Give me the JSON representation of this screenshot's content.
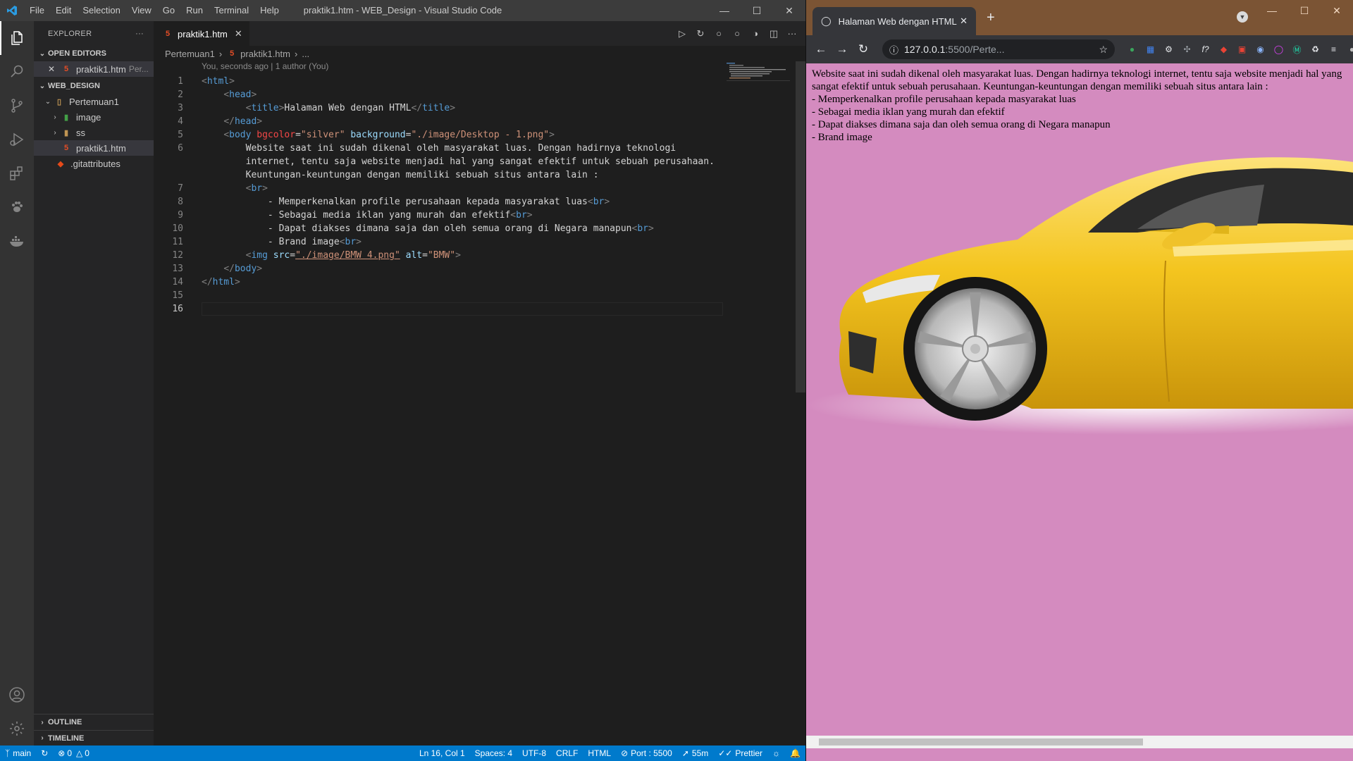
{
  "vscode": {
    "menu": [
      "File",
      "Edit",
      "Selection",
      "View",
      "Go",
      "Run",
      "Terminal",
      "Help"
    ],
    "window_title": "praktik1.htm - WEB_Design - Visual Studio Code",
    "explorer": {
      "title": "EXPLORER",
      "open_editors_label": "OPEN EDITORS",
      "open_editor": {
        "name": "praktik1.htm",
        "path": "Per..."
      },
      "workspace_label": "WEB_DESIGN",
      "tree": [
        {
          "name": "Pertemuan1"
        },
        {
          "name": "image"
        },
        {
          "name": "ss"
        },
        {
          "name": "praktik1.htm"
        },
        {
          "name": ".gitattributes"
        }
      ],
      "outline_label": "OUTLINE",
      "timeline_label": "TIMELINE"
    },
    "tab_label": "praktik1.htm",
    "breadcrumb": {
      "folder": "Pertemuan1",
      "file": "praktik1.htm",
      "more": "..."
    },
    "codelens": "You, seconds ago | 1 author (You)",
    "code": {
      "line_numbers": [
        "1",
        "2",
        "3",
        "4",
        "5",
        "6",
        "7",
        "8",
        "9",
        "10",
        "11",
        "12",
        "13",
        "14",
        "15",
        "16"
      ],
      "l1": {
        "open": "<",
        "tag": "html",
        "close": ">"
      },
      "l2": {
        "open": "<",
        "tag": "head",
        "close": ">"
      },
      "l3": {
        "tag_open": "title",
        "text": "Halaman Web dengan HTML",
        "tag_close": "title"
      },
      "l4": {
        "tag": "head"
      },
      "l5": {
        "tag": "body",
        "attr1": "bgcolor",
        "val1": "\"silver\"",
        "attr2": "background",
        "val2": "\"./image/Desktop - 1.png\""
      },
      "l6a": "Website saat ini sudah dikenal oleh masyarakat luas. Dengan hadirnya teknologi",
      "l6b": "internet, tentu saja website menjadi hal yang sangat efektif untuk sebuah perusahaan.",
      "l6c": "Keuntungan-keuntungan dengan memiliki sebuah situs antara lain :",
      "l7": "br",
      "l8": "- Memperkenalkan profile perusahaan kepada masyarakat luas",
      "l9": "- Sebagai media iklan yang murah dan efektif",
      "l10": "- Dapat diakses dimana saja dan oleh semua orang di Negara manapun",
      "l11": "- Brand image",
      "l12": {
        "tag": "img",
        "attr1": "src",
        "val1": "\"./image/BMW 4.png\"",
        "attr2": "alt",
        "val2": "\"BMW\""
      },
      "l13": {
        "tag": "body"
      },
      "l14": {
        "tag": "html"
      }
    },
    "status": {
      "branch": "main",
      "errors": "0",
      "warnings": "0",
      "position": "Ln 16, Col 1",
      "spaces": "Spaces: 4",
      "encoding": "UTF-8",
      "eol": "CRLF",
      "language": "HTML",
      "port": "Port : 5500",
      "time": "55m",
      "prettier": "Prettier"
    }
  },
  "chrome": {
    "tab_title": "Halaman Web dengan HTML",
    "url_host": "127.0.0.1",
    "url_rest": ":5500/Perte...",
    "page": {
      "paragraph": "Website saat ini sudah dikenal oleh masyarakat luas. Dengan hadirnya teknologi internet, tentu saja website menjadi hal yang sangat efektif untuk sebuah perusahaan. Keuntungan-keuntungan dengan memiliki sebuah situs antara lain :",
      "items": [
        "- Memperkenalkan profile perusahaan kepada masyarakat luas",
        "- Sebagai media iklan yang murah dan efektif",
        "- Dapat diakses dimana saja dan oleh semua orang di Negara manapun",
        "- Brand image"
      ],
      "image_alt": "BMW"
    },
    "background_color": "#d48bbf"
  },
  "colors": {
    "statusbar": "#007acc",
    "car_yellow": "#f2c21b",
    "chrome_tabstrip": "#7b5434"
  }
}
